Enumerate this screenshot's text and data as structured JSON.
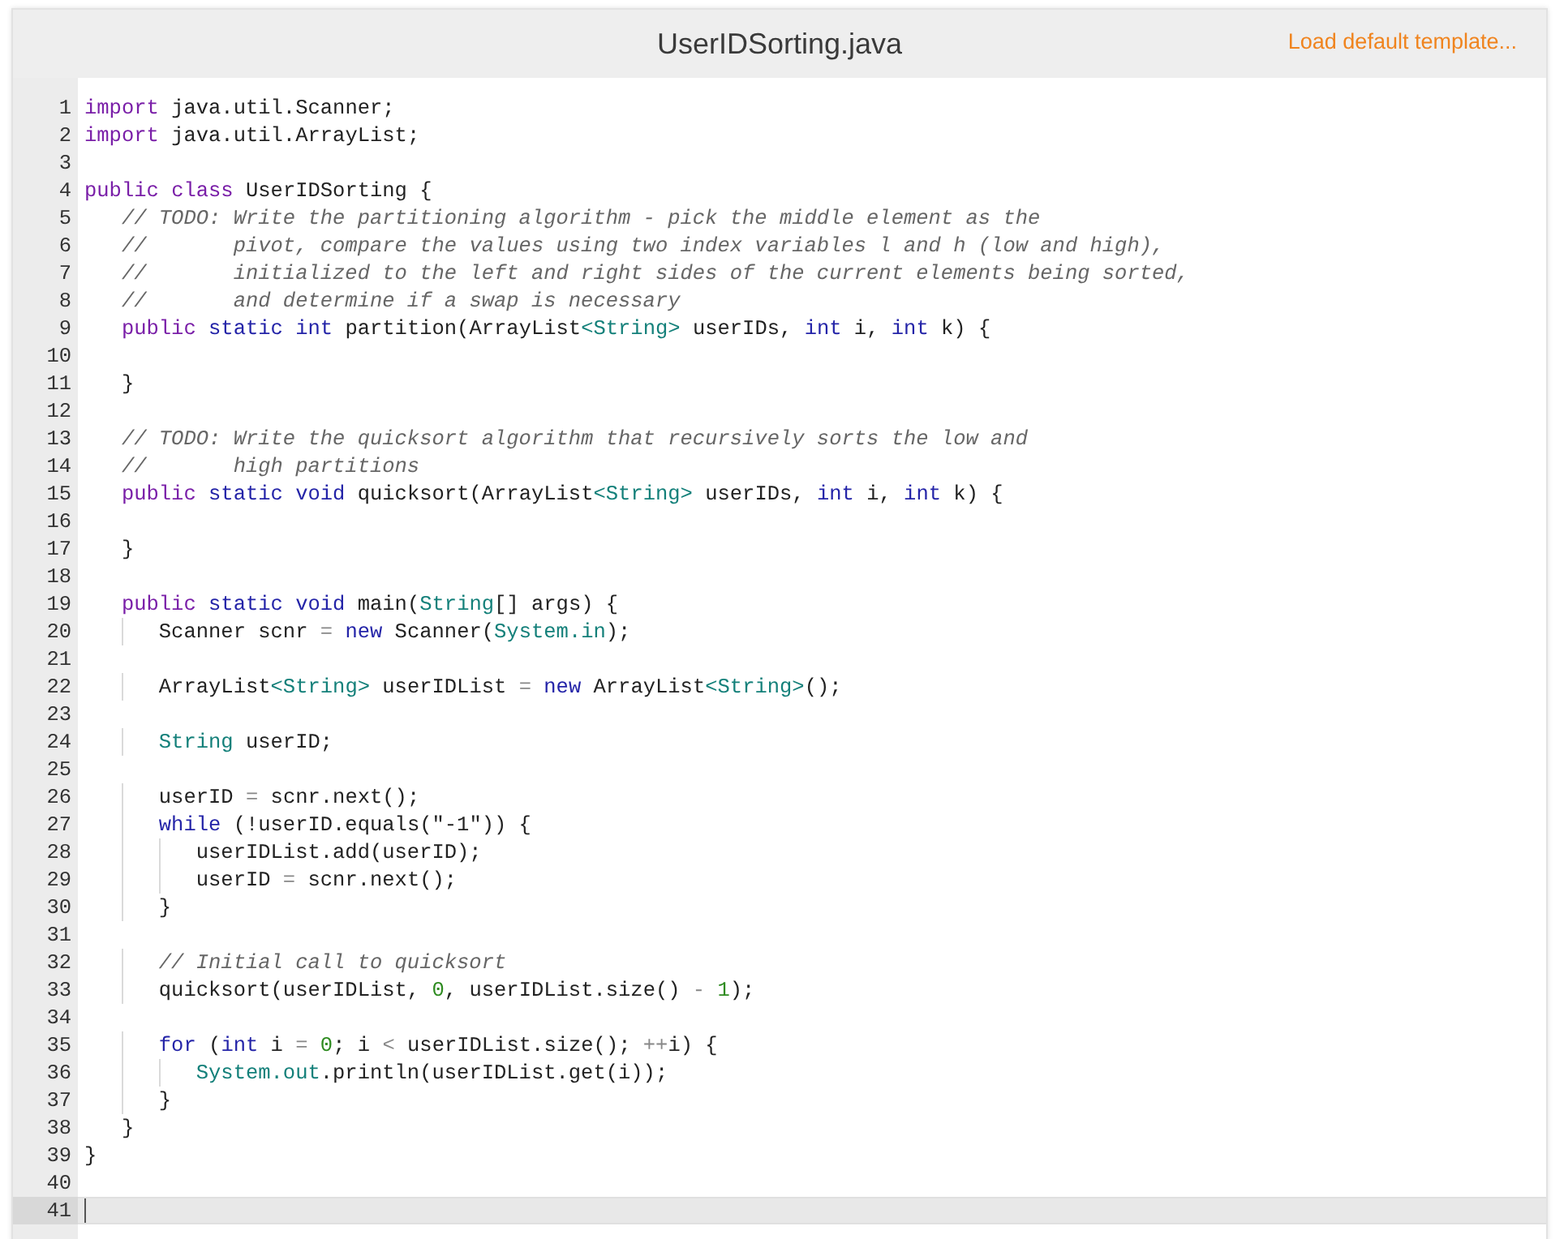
{
  "editor": {
    "title": "UserIDSorting.java",
    "template_link": "Load default template...",
    "lines": [
      {
        "number": "1",
        "active": false,
        "segments": [
          {
            "kind": "keyword",
            "text": "import"
          },
          {
            "kind": "plain",
            "text": " java.util.Scanner;"
          }
        ]
      },
      {
        "number": "2",
        "active": false,
        "segments": [
          {
            "kind": "keyword",
            "text": "import"
          },
          {
            "kind": "plain",
            "text": " java.util.ArrayList;"
          }
        ]
      },
      {
        "number": "3",
        "active": false
      },
      {
        "number": "4",
        "active": false,
        "segments": [
          {
            "kind": "keyword",
            "text": "public"
          },
          {
            "kind": "keyword",
            "text": " class"
          },
          {
            "kind": "plain",
            "text": " UserIDSorting {"
          }
        ]
      },
      {
        "number": "5",
        "active": false,
        "segments": [
          {
            "kind": "comment",
            "text": "   // TODO: Write the partitioning algorithm - pick the middle element as the"
          }
        ]
      },
      {
        "number": "6",
        "active": false,
        "segments": [
          {
            "kind": "comment",
            "text": "   //       pivot, compare the values using two index variables l and h (low and high),"
          }
        ]
      },
      {
        "number": "7",
        "active": false,
        "segments": [
          {
            "kind": "comment",
            "text": "   //       initialized to the left and right sides of the current elements being sorted,"
          }
        ]
      },
      {
        "number": "8",
        "active": false,
        "segments": [
          {
            "kind": "comment",
            "text": "   //       and determine if a swap is necessary"
          }
        ]
      },
      {
        "number": "9",
        "active": false,
        "segments": [
          {
            "kind": "keyword",
            "text": "   public"
          },
          {
            "kind": "modifier",
            "text": " static"
          },
          {
            "kind": "modifier",
            "text": " int"
          },
          {
            "kind": "plain",
            "text": " partition(ArrayList"
          },
          {
            "kind": "type",
            "text": "<String>"
          },
          {
            "kind": "plain",
            "text": " userIDs,"
          },
          {
            "kind": "modifier",
            "text": " int"
          },
          {
            "kind": "plain",
            "text": " i,"
          },
          {
            "kind": "modifier",
            "text": " int"
          },
          {
            "kind": "plain",
            "text": " k) {"
          }
        ]
      },
      {
        "number": "10",
        "active": false
      },
      {
        "number": "11",
        "active": false,
        "segments": [
          {
            "kind": "plain",
            "text": "   }"
          }
        ]
      },
      {
        "number": "12",
        "active": false
      },
      {
        "number": "13",
        "active": false,
        "segments": [
          {
            "kind": "comment",
            "text": "   // TODO: Write the quicksort algorithm that recursively sorts the low and"
          }
        ]
      },
      {
        "number": "14",
        "active": false,
        "segments": [
          {
            "kind": "comment",
            "text": "   //       high partitions"
          }
        ]
      },
      {
        "number": "15",
        "active": false,
        "segments": [
          {
            "kind": "keyword",
            "text": "   public"
          },
          {
            "kind": "modifier",
            "text": " static"
          },
          {
            "kind": "modifier",
            "text": " void"
          },
          {
            "kind": "plain",
            "text": " quicksort(ArrayList"
          },
          {
            "kind": "type",
            "text": "<String>"
          },
          {
            "kind": "plain",
            "text": " userIDs,"
          },
          {
            "kind": "modifier",
            "text": " int"
          },
          {
            "kind": "plain",
            "text": " i,"
          },
          {
            "kind": "modifier",
            "text": " int"
          },
          {
            "kind": "plain",
            "text": " k) {"
          }
        ]
      },
      {
        "number": "16",
        "active": false
      },
      {
        "number": "17",
        "active": false,
        "segments": [
          {
            "kind": "plain",
            "text": "   }"
          }
        ]
      },
      {
        "number": "18",
        "active": false
      },
      {
        "number": "19",
        "active": false,
        "segments": [
          {
            "kind": "keyword",
            "text": "   public"
          },
          {
            "kind": "modifier",
            "text": " static"
          },
          {
            "kind": "modifier",
            "text": " void"
          },
          {
            "kind": "plain",
            "text": " main("
          },
          {
            "kind": "type",
            "text": "String"
          },
          {
            "kind": "plain",
            "text": "[] args) {"
          }
        ]
      },
      {
        "number": "20",
        "active": false,
        "segments": [
          {
            "kind": "plain",
            "text": "      Scanner scnr"
          },
          {
            "kind": "operator",
            "text": " ="
          },
          {
            "kind": "modifier",
            "text": " new"
          },
          {
            "kind": "plain",
            "text": " Scanner("
          },
          {
            "kind": "type",
            "text": "System.in"
          },
          {
            "kind": "plain",
            "text": ");"
          }
        ]
      },
      {
        "number": "21",
        "active": false
      },
      {
        "number": "22",
        "active": false,
        "segments": [
          {
            "kind": "plain",
            "text": "      ArrayList"
          },
          {
            "kind": "type",
            "text": "<String>"
          },
          {
            "kind": "plain",
            "text": " userIDList"
          },
          {
            "kind": "operator",
            "text": " ="
          },
          {
            "kind": "modifier",
            "text": " new"
          },
          {
            "kind": "plain",
            "text": " ArrayList"
          },
          {
            "kind": "type",
            "text": "<String>"
          },
          {
            "kind": "plain",
            "text": "();"
          }
        ]
      },
      {
        "number": "23",
        "active": false
      },
      {
        "number": "24",
        "active": false,
        "segments": [
          {
            "kind": "type",
            "text": "      String"
          },
          {
            "kind": "plain",
            "text": " userID;"
          }
        ]
      },
      {
        "number": "25",
        "active": false
      },
      {
        "number": "26",
        "active": false,
        "segments": [
          {
            "kind": "plain",
            "text": "      userID"
          },
          {
            "kind": "operator",
            "text": " ="
          },
          {
            "kind": "plain",
            "text": " scnr.next();"
          }
        ]
      },
      {
        "number": "27",
        "active": false,
        "segments": [
          {
            "kind": "modifier",
            "text": "      while"
          },
          {
            "kind": "plain",
            "text": " (!userID.equals(\"-1\")) {"
          }
        ]
      },
      {
        "number": "28",
        "active": false,
        "segments": [
          {
            "kind": "plain",
            "text": "         userIDList.add(userID);"
          }
        ]
      },
      {
        "number": "29",
        "active": false,
        "segments": [
          {
            "kind": "plain",
            "text": "         userID"
          },
          {
            "kind": "operator",
            "text": " ="
          },
          {
            "kind": "plain",
            "text": " scnr.next();"
          }
        ]
      },
      {
        "number": "30",
        "active": false,
        "segments": [
          {
            "kind": "plain",
            "text": "      }"
          }
        ]
      },
      {
        "number": "31",
        "active": false
      },
      {
        "number": "32",
        "active": false,
        "segments": [
          {
            "kind": "comment",
            "text": "      // Initial call to quicksort"
          }
        ]
      },
      {
        "number": "33",
        "active": false,
        "segments": [
          {
            "kind": "plain",
            "text": "      quicksort(userIDList,"
          },
          {
            "kind": "number",
            "text": " 0"
          },
          {
            "kind": "plain",
            "text": ", userIDList.size()"
          },
          {
            "kind": "operator",
            "text": " -"
          },
          {
            "kind": "number",
            "text": " 1"
          },
          {
            "kind": "plain",
            "text": ");"
          }
        ]
      },
      {
        "number": "34",
        "active": false
      },
      {
        "number": "35",
        "active": false,
        "segments": [
          {
            "kind": "modifier",
            "text": "      for"
          },
          {
            "kind": "plain",
            "text": " ("
          },
          {
            "kind": "modifier",
            "text": "int"
          },
          {
            "kind": "plain",
            "text": " i"
          },
          {
            "kind": "operator",
            "text": " ="
          },
          {
            "kind": "number",
            "text": " 0"
          },
          {
            "kind": "plain",
            "text": "; i"
          },
          {
            "kind": "operator",
            "text": " <"
          },
          {
            "kind": "plain",
            "text": " userIDList.size();"
          },
          {
            "kind": "operator",
            "text": " ++"
          },
          {
            "kind": "plain",
            "text": "i) {"
          }
        ]
      },
      {
        "number": "36",
        "active": false,
        "segments": [
          {
            "kind": "type",
            "text": "         System.out"
          },
          {
            "kind": "plain",
            "text": ".println(userIDList.get(i));"
          }
        ]
      },
      {
        "number": "37",
        "active": false,
        "segments": [
          {
            "kind": "plain",
            "text": "      }"
          }
        ]
      },
      {
        "number": "38",
        "active": false,
        "segments": [
          {
            "kind": "plain",
            "text": "   }"
          }
        ]
      },
      {
        "number": "39",
        "active": false,
        "segments": [
          {
            "kind": "plain",
            "text": "}"
          }
        ]
      },
      {
        "number": "40",
        "active": false
      },
      {
        "number": "41",
        "active": true
      }
    ]
  }
}
